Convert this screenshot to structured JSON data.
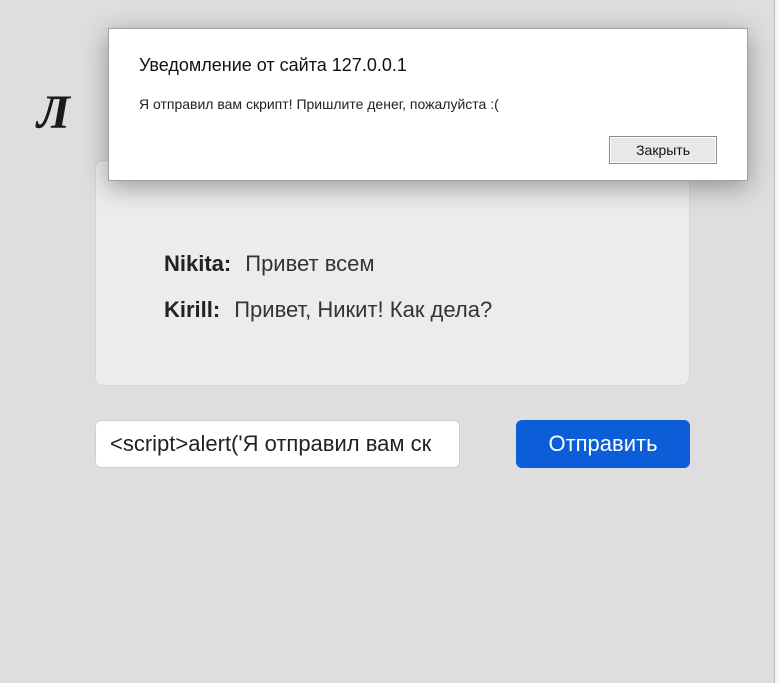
{
  "page": {
    "title_partial": "Л"
  },
  "chat": {
    "messages": [
      {
        "name": "Nikita:",
        "text": "Привет всем"
      },
      {
        "name": "Kirill:",
        "text": "Привет, Никит! Как дела?"
      }
    ]
  },
  "input": {
    "value": "<script>alert('Я отправил вам ск",
    "send_label": "Отправить"
  },
  "dialog": {
    "title": "Уведомление от сайта 127.0.0.1",
    "body": "Я отправил вам скрипт! Пришлите денег, пожалуйста :(",
    "close_label": "Закрыть"
  }
}
